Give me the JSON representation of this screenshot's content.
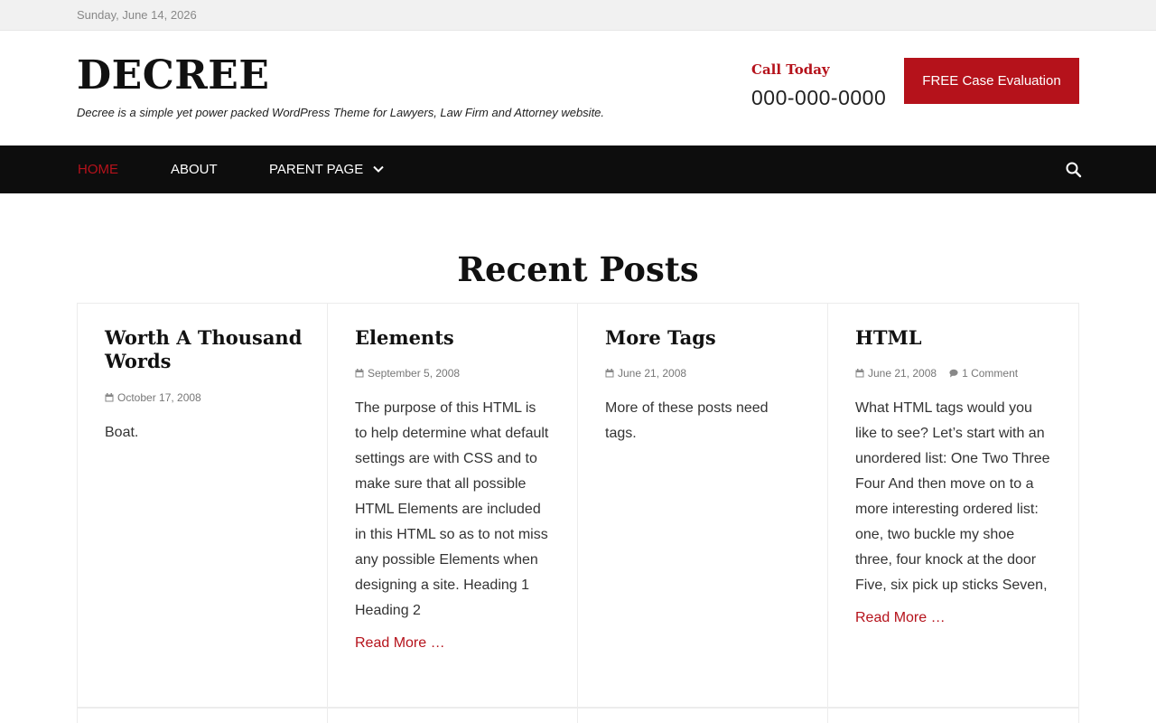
{
  "topbar": {
    "date": "Sunday, June 14, 2026"
  },
  "header": {
    "site_title": "DECREE",
    "tagline": "Decree is a simple yet power packed WordPress Theme for Lawyers, Law Firm and Attorney website.",
    "call_label": "Call Today",
    "call_number": "000-000-0000",
    "cta_label": "FREE Case Evaluation"
  },
  "nav": {
    "items": [
      {
        "label": "HOME",
        "active": true
      },
      {
        "label": "ABOUT",
        "active": false
      },
      {
        "label": "PARENT PAGE",
        "active": false
      }
    ],
    "icons": {
      "dropdown": "chevron-down-icon",
      "search": "search-icon"
    }
  },
  "colors": {
    "accent": "#b5121b",
    "nav_bg": "#0d0d0d",
    "topbar_bg": "#f1f1f1"
  },
  "section": {
    "title": "Recent Posts"
  },
  "posts": [
    {
      "title": "Worth A Thousand Words",
      "date": "October 17, 2008",
      "comments": "",
      "excerpt": "Boat.",
      "read_more": ""
    },
    {
      "title": "Elements",
      "date": "September 5, 2008",
      "comments": "",
      "excerpt": "The purpose of this HTML is to help determine what default settings are with CSS and to make sure that all possible HTML Elements are included in this HTML so as to not miss any possible Elements when designing a site. Heading 1 Heading 2",
      "read_more": "Read More …"
    },
    {
      "title": "More Tags",
      "date": "June 21, 2008",
      "comments": "",
      "excerpt": "More of these posts need tags.",
      "read_more": ""
    },
    {
      "title": "HTML",
      "date": "June 21, 2008",
      "comments": "1 Comment",
      "excerpt": "What HTML tags would you like to see? Let’s start with an unordered list: One Two Three Four And then move on to a more interesting ordered list: one, two buckle my shoe three, four knock at the door Five, six pick up sticks Seven,",
      "read_more": "Read More …"
    }
  ]
}
